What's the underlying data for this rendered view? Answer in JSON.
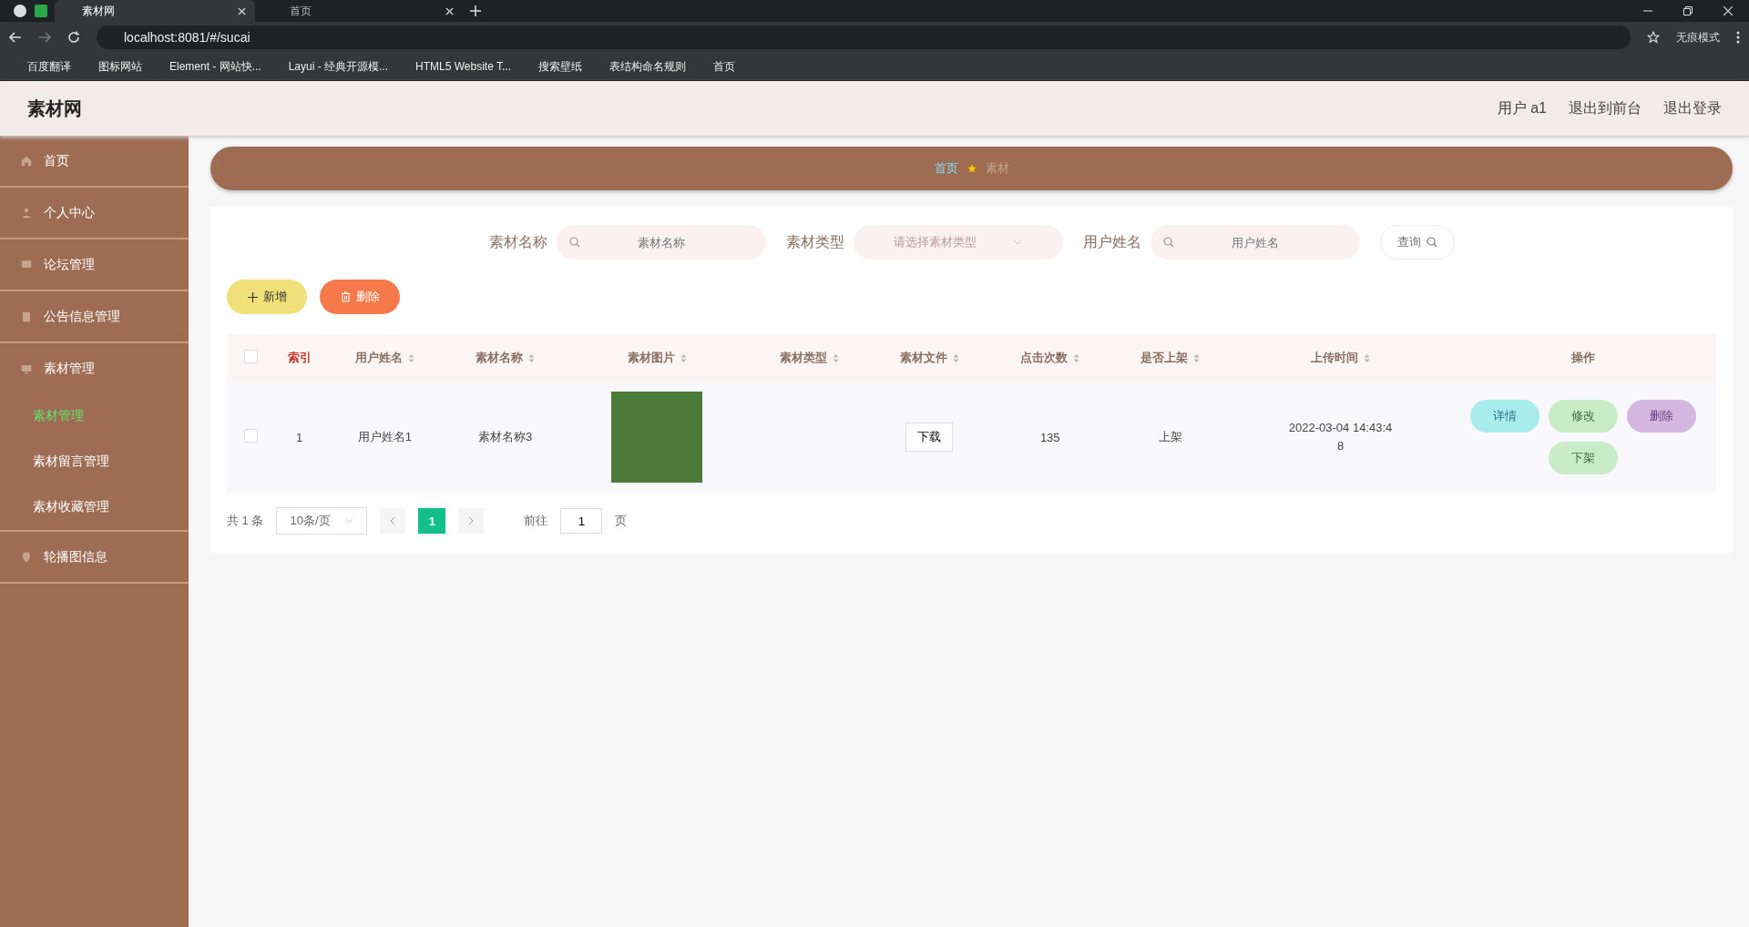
{
  "browser": {
    "tabs": [
      {
        "title": "素材网",
        "selected": true
      },
      {
        "title": "首页",
        "selected": false
      }
    ],
    "address": "localhost:8081/#/sucai",
    "profile": "无痕模式",
    "bookmarks": [
      {
        "label": "百度翻译"
      },
      {
        "label": "图标网站"
      },
      {
        "label": "Element - 网站快..."
      },
      {
        "label": "Layui - 经典开源模..."
      },
      {
        "label": "HTML5 Website T..."
      },
      {
        "label": "搜索壁纸"
      },
      {
        "label": "表结构命名规则"
      },
      {
        "label": "首页"
      }
    ]
  },
  "app": {
    "title": "素材网",
    "header_links": [
      "用户 a1",
      "退出到前台",
      "退出登录"
    ]
  },
  "sidebar": {
    "items": [
      {
        "label": "首页"
      },
      {
        "label": "个人中心"
      },
      {
        "label": "论坛管理"
      },
      {
        "label": "公告信息管理"
      },
      {
        "label": "素材管理",
        "children": [
          {
            "label": "素材管理",
            "selected": true
          },
          {
            "label": "素材留言管理",
            "selected": false
          },
          {
            "label": "素材收藏管理",
            "selected": false
          }
        ]
      },
      {
        "label": "轮播图信息"
      }
    ]
  },
  "breadcrumb": [
    "首页",
    "素材"
  ],
  "search": {
    "fields": [
      {
        "label": "素材名称",
        "placeholder": "素材名称",
        "kind": "text"
      },
      {
        "label": "素材类型",
        "placeholder": "请选择素材类型",
        "kind": "select"
      },
      {
        "label": "用户姓名",
        "placeholder": "用户姓名",
        "kind": "text"
      }
    ],
    "button": "查询"
  },
  "actions": [
    {
      "label": "新增",
      "kind": "add"
    },
    {
      "label": "删除",
      "kind": "delete"
    }
  ],
  "table": {
    "all_checked": false,
    "columns": [
      {
        "label": "索引",
        "sortable": false
      },
      {
        "label": "用户姓名",
        "sortable": true
      },
      {
        "label": "素材名称",
        "sortable": true
      },
      {
        "label": "素材图片",
        "sortable": true
      },
      {
        "label": "素材类型",
        "sortable": true
      },
      {
        "label": "素材文件",
        "sortable": true
      },
      {
        "label": "点击次数",
        "sortable": true
      },
      {
        "label": "是否上架",
        "sortable": true
      },
      {
        "label": "上传时间",
        "sortable": true
      },
      {
        "label": "操作",
        "sortable": false
      }
    ],
    "rows": [
      {
        "checked": false,
        "index": "1",
        "user": "用户姓名1",
        "name": "素材名称3",
        "file_button": "下载",
        "clicks": "135",
        "on_shelf": "上架",
        "time": "2022-03-04 14:43:48",
        "operations": [
          {
            "label": "详情",
            "kind": "detail"
          },
          {
            "label": "修改",
            "kind": "edit"
          },
          {
            "label": "删除",
            "kind": "delete"
          },
          {
            "label": "下架",
            "kind": "unshelf"
          }
        ]
      }
    ]
  },
  "pagination": {
    "total": "共 1 条",
    "page_size": "10条/页",
    "pages": [
      {
        "label": "1",
        "selected": true
      }
    ],
    "goto": "前往",
    "goto_value": "1",
    "unit": "页"
  }
}
